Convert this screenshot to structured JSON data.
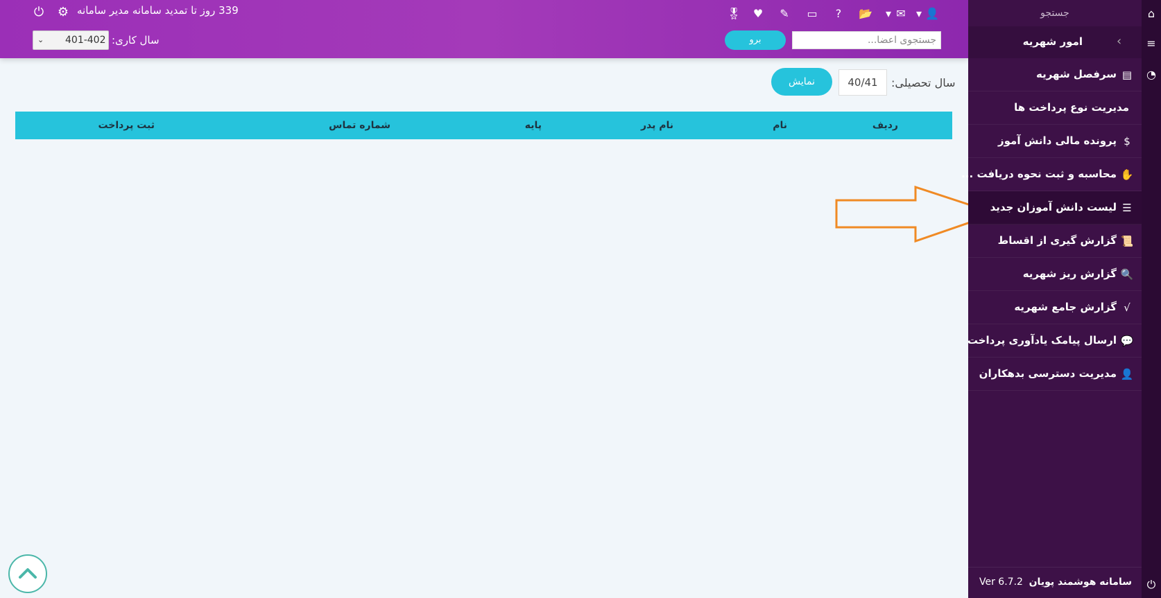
{
  "header": {
    "expire_text": "339 روز تا تمدید سامانه مدیر سامانه",
    "working_year_label": "سال کاری:",
    "working_year_value": "401-402",
    "search_placeholder": "جستجوی اعضا...",
    "go_label": "برو",
    "toolbar_icons": [
      "user-lock-icon",
      "envelope-icon",
      "folder-open-icon",
      "question-icon",
      "window-icon",
      "edit-icon",
      "heartbeat-icon",
      "medal-icon"
    ]
  },
  "filter": {
    "label": "سال تحصیلی:",
    "value": "40/41",
    "show_label": "نمایش"
  },
  "table": {
    "columns": [
      "ردیف",
      "نام",
      "نام پدر",
      "پایه",
      "شماره تماس",
      "ثبت پرداخت"
    ],
    "rows": []
  },
  "sidebar": {
    "search_label": "جستجو",
    "section_title": "امور شهریه",
    "items": [
      {
        "label": "سرفصل شهریه",
        "icon": "money-check-icon"
      },
      {
        "label": "مدیریت نوع پرداخت ها",
        "icon": ""
      },
      {
        "label": "پرونده مالی دانش آموز",
        "icon": "dollar-icon"
      },
      {
        "label": "محاسبه و ثبت نحوه دریافت ...",
        "icon": "hand-holding-usd-icon"
      },
      {
        "label": "لیست دانش آموزان جدید",
        "icon": "table-list-icon"
      },
      {
        "label": "گزارش گیری از اقساط",
        "icon": "scroll-icon"
      },
      {
        "label": "گزارش ریز شهریه",
        "icon": "search-dollar-icon"
      },
      {
        "label": "گزارش جامع شهریه",
        "icon": "square-root-icon"
      },
      {
        "label": "ارسال پیامک یادآوری پرداخت",
        "icon": "comment-dollar-icon"
      },
      {
        "label": "مدیریت دسترسی بدهکاران",
        "icon": "user-lock-icon"
      }
    ],
    "footer_name": "سامانه هوشمند پویان",
    "footer_version": "Ver 6.7.2"
  },
  "colors": {
    "header_purple": "#9b2fb7",
    "accent_cyan": "#26c3dc",
    "sidebar_bg": "#3d1147",
    "annotation_orange": "#f08a24"
  }
}
